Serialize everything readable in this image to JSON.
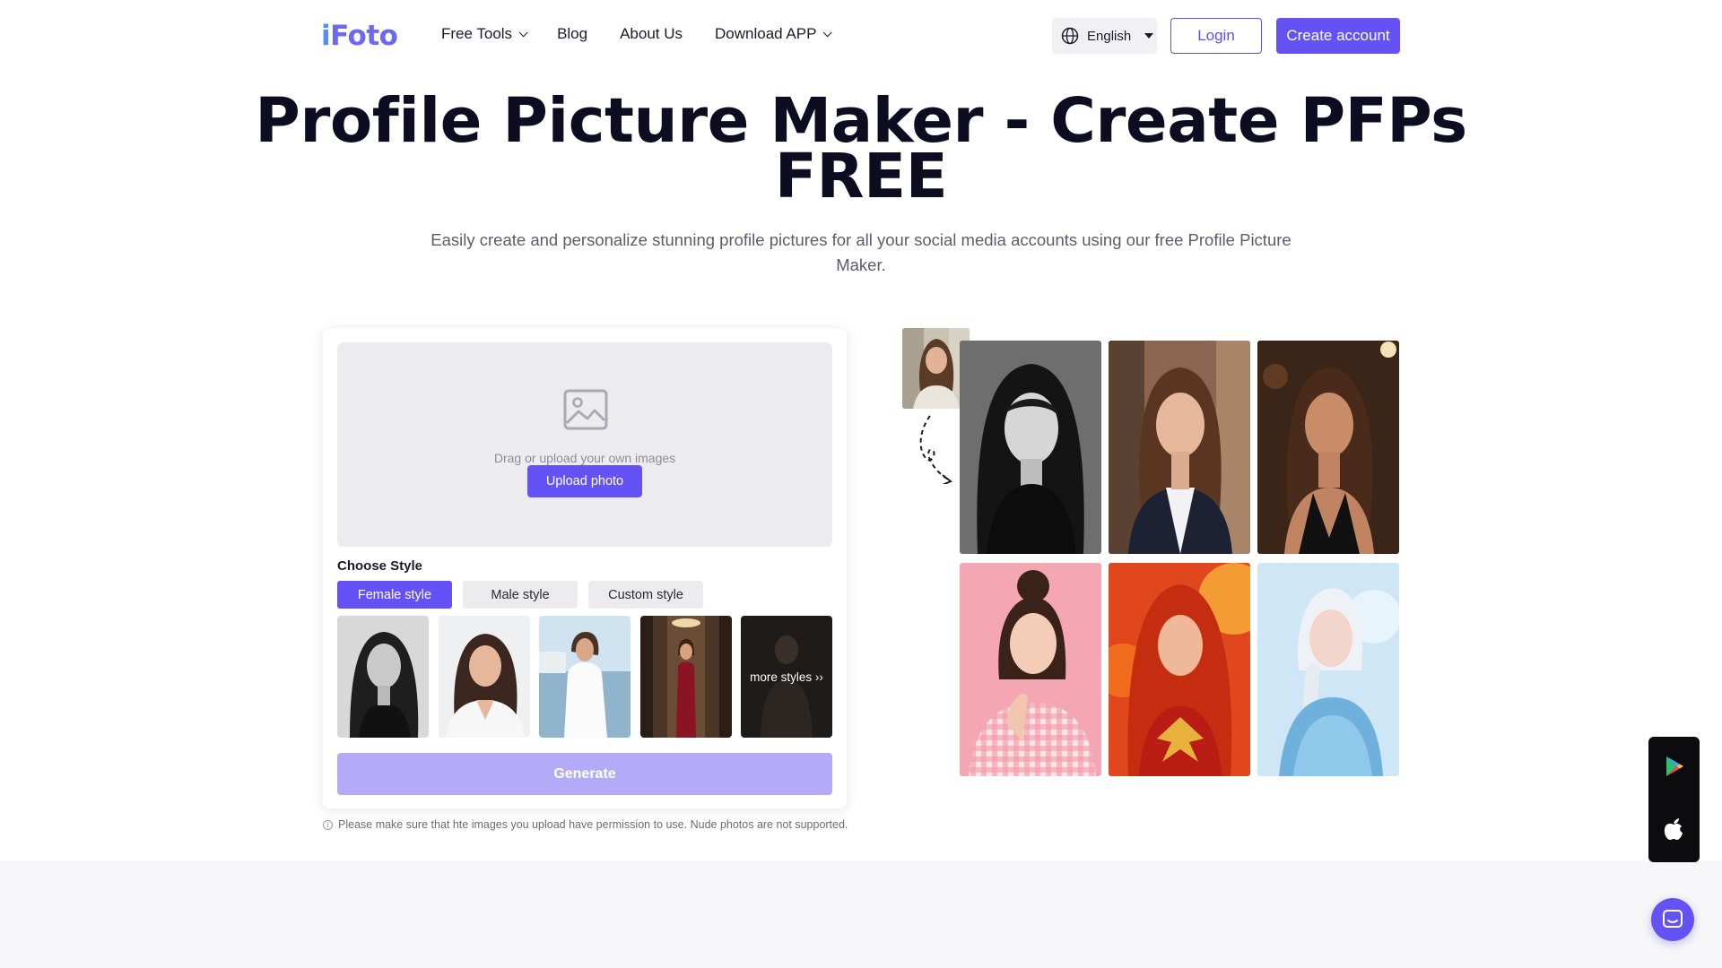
{
  "header": {
    "logo_i": "i",
    "logo_rest": "Foto",
    "nav": [
      {
        "label": "Free Tools",
        "dropdown": true
      },
      {
        "label": "Blog",
        "dropdown": false
      },
      {
        "label": "About Us",
        "dropdown": false
      },
      {
        "label": "Download APP",
        "dropdown": true
      }
    ],
    "language": "English",
    "login": "Login",
    "create_account": "Create account"
  },
  "hero": {
    "title_line1": "Profile Picture Maker - Create PFPs",
    "title_line2": "FREE",
    "subtitle": "Easily create and personalize stunning profile pictures for all your social media accounts using our free Profile Picture Maker."
  },
  "tool": {
    "drop_text": "Drag or upload your own images",
    "upload_button": "Upload photo",
    "choose_style_label": "Choose Style",
    "style_tabs": [
      {
        "label": "Female style",
        "active": true
      },
      {
        "label": "Male style",
        "active": false
      },
      {
        "label": "Custom style",
        "active": false
      }
    ],
    "more_styles": "more styles ››",
    "generate_button": "Generate",
    "notice": "Please make sure that hte images you upload have permission to use. Nude photos are not supported."
  },
  "floating": {
    "icons": [
      "google-play-icon",
      "apple-icon",
      "chat-icon"
    ]
  },
  "colors": {
    "accent": "#6552f5",
    "accent_disabled": "#b4abf8",
    "logo_blue": "#4f8ff7",
    "logo_purple": "#6d6af2"
  }
}
